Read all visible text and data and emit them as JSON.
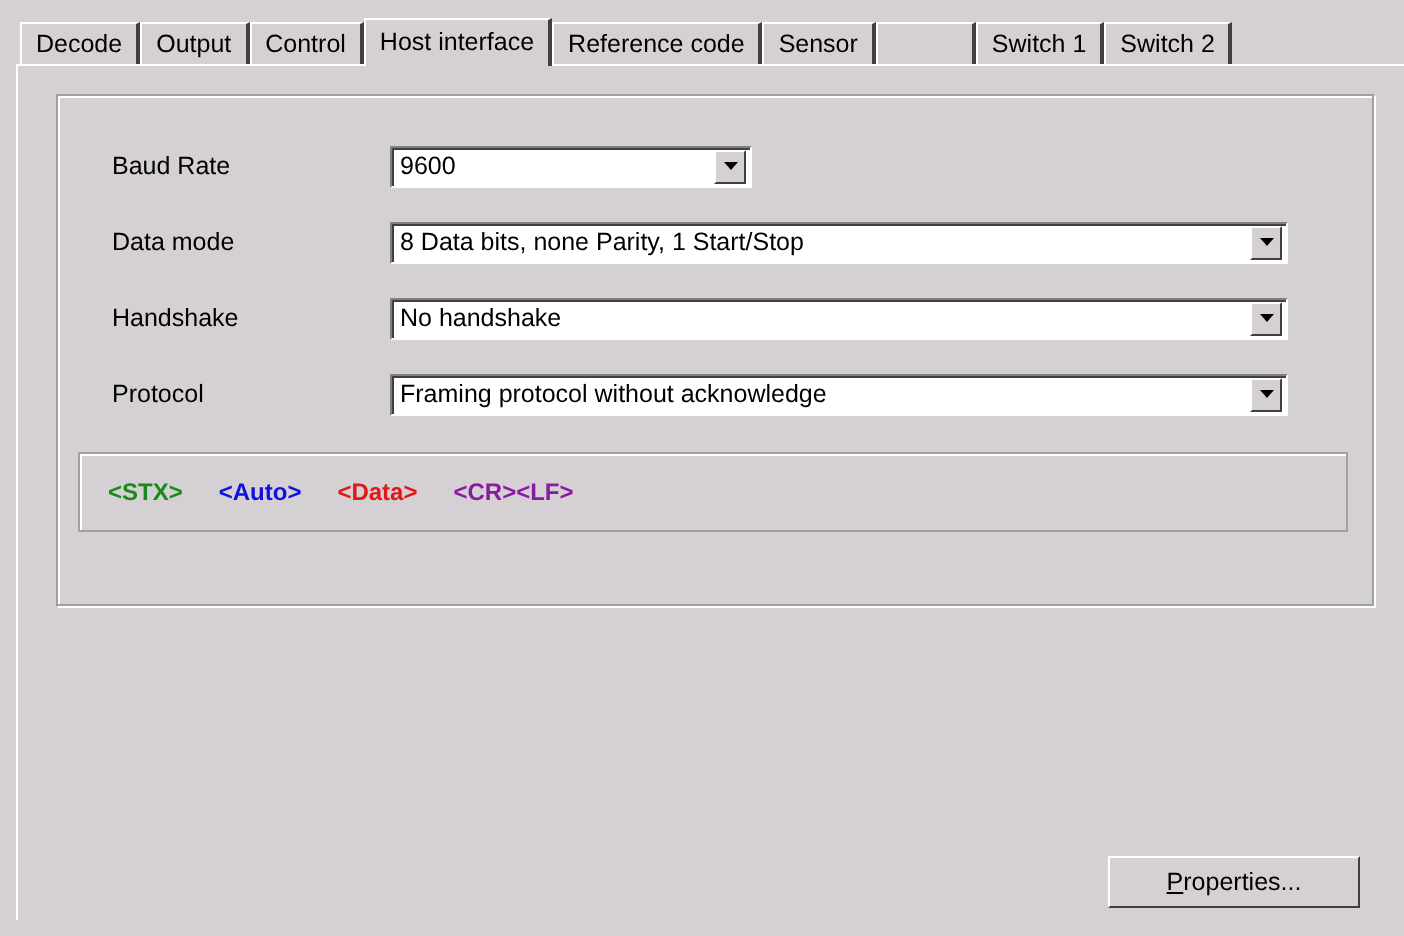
{
  "tabs": [
    {
      "kind": "text",
      "label": "Decode",
      "selected": false
    },
    {
      "kind": "text",
      "label": "Output",
      "selected": false
    },
    {
      "kind": "text",
      "label": "Control",
      "selected": false
    },
    {
      "kind": "text",
      "label": "Host interface",
      "selected": true
    },
    {
      "kind": "text",
      "label": "Reference code",
      "selected": false
    },
    {
      "kind": "text",
      "label": "Sensor",
      "selected": false
    },
    {
      "kind": "blank",
      "selected": false
    },
    {
      "kind": "text",
      "label": "Switch 1",
      "selected": false
    },
    {
      "kind": "text",
      "label": "Switch 2",
      "selected": false
    }
  ],
  "settings": [
    {
      "label": "Baud Rate",
      "value": "9600",
      "kind": "short"
    },
    {
      "label": "Data mode",
      "value": "8 Data bits, none Parity, 1 Start/Stop",
      "kind": "long"
    },
    {
      "label": "Handshake",
      "value": "No handshake",
      "kind": "long"
    },
    {
      "label": "Protocol",
      "value": "Framing protocol without acknowledge",
      "kind": "long"
    }
  ],
  "frame_tokens": [
    {
      "text": "<STX>",
      "color": "#1a8a1a"
    },
    {
      "text": "<Auto>",
      "color": "#1010e0"
    },
    {
      "text": "<Data>",
      "color": "#e01818"
    },
    {
      "text": "<CR><LF>",
      "color": "#8a1aa0"
    }
  ],
  "properties_button": "Properties..."
}
